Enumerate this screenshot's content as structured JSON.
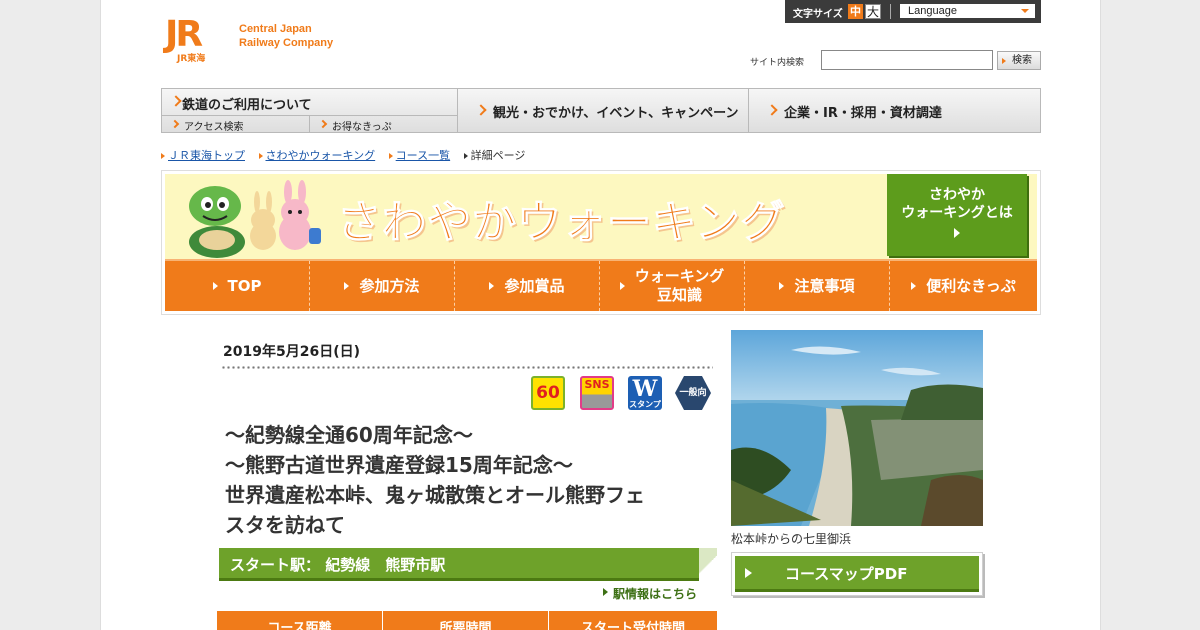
{
  "header": {
    "logo_mark": "JR",
    "logo_sub": "JR東海",
    "company_line1": "Central Japan",
    "company_line2": "Railway Company"
  },
  "util": {
    "font_size_label": "文字サイズ",
    "font_size_mid": "中",
    "font_size_big": "大",
    "language": "Language"
  },
  "search": {
    "label": "サイト内検索",
    "value": "",
    "button": "検索"
  },
  "gnav": {
    "rail": "鉄道のご利用について",
    "access": "アクセス検索",
    "tickets": "お得なきっぷ",
    "tourism": "観光・おでかけ、イベント、キャンペーン",
    "corporate": "企業・IR・採用・資材調達"
  },
  "breadcrumb": {
    "home": "ＪＲ東海トップ",
    "walking": "さわやかウォーキング",
    "courses": "コース一覧",
    "current": "詳細ページ"
  },
  "banner": {
    "title": "さわやかウォーキング",
    "about_line1": "さわやか",
    "about_line2": "ウォーキングとは",
    "subnav": [
      "TOP",
      "参加方法",
      "参加賞品",
      "ウォーキング",
      "豆知識",
      "注意事項",
      "便利なきっぷ"
    ]
  },
  "event": {
    "date": "2019年5月26日(日)",
    "badges": {
      "anniv": "60",
      "sns": "SNS",
      "stamp_letter": "W",
      "stamp_label": "スタンプ",
      "general": "一般向"
    },
    "title_line1": "～紀勢線全通60周年記念～",
    "title_line2": "～熊野古道世界遺産登録15周年記念～",
    "title_line3": "世界遺産松本峠、鬼ヶ城散策とオール熊野フェ",
    "title_line4": "スタを訪ねて",
    "start_station": "スタート駅：  紀勢線　熊野市駅",
    "station_info": "駅情報はこちら",
    "table_headers": [
      "コース距離",
      "所要時間",
      "スタート受付時間"
    ]
  },
  "photo": {
    "caption": "松本峠からの七里御浜"
  },
  "course_map_button": "コースマップPDF",
  "colors": {
    "brand_orange": "#f07b1a",
    "green": "#6ea22a",
    "banner_yellow": "#fdf8c0"
  }
}
